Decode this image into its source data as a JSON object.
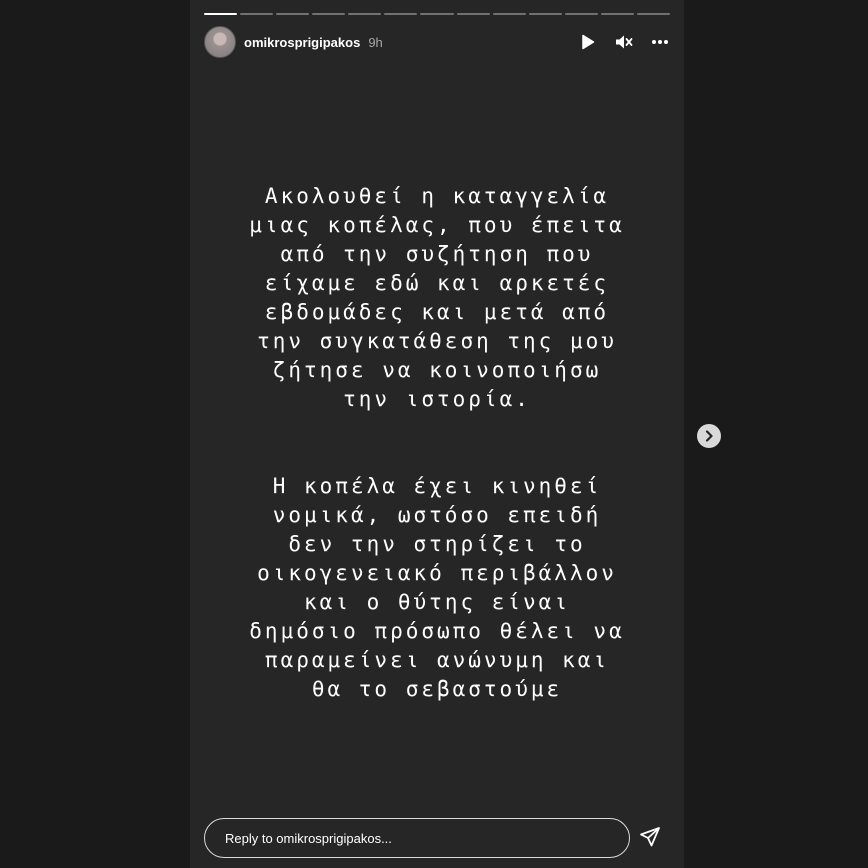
{
  "story": {
    "progress": {
      "total_segments": 13,
      "completed_segments": 1
    },
    "header": {
      "username": "omikrosprigipakos",
      "time": "9h",
      "icons": [
        "play-icon",
        "mute-icon",
        "more-icon"
      ]
    },
    "text": {
      "paragraph1": "Ακολουθεί η καταγγελία\nμιας κοπέλας, που έπειτα\nαπό την συζήτηση που\nείχαμε εδώ και αρκετές\nεβδομάδες και μετά από\nτην συγκατάθεση της μου\nζήτησε να κοινοποιήσω\nτην ιστορία.",
      "paragraph2": "Η κοπέλα έχει κινηθεί\nνομικά, ωστόσο επειδή\nδεν την στηρίζει το\nοικογενειακό περιβάλλον\nκαι ο θύτης είναι\nδημόσιο πρόσωπο θέλει να\nπαραμείνει ανώνυμη και\nθα το σεβαστούμε"
    },
    "reply": {
      "placeholder": "Reply to omikrosprigipakos..."
    },
    "colors": {
      "background": "#262626",
      "page": "#1a1a1a",
      "text": "#ffffff",
      "muted": "#a8a8a8"
    }
  }
}
